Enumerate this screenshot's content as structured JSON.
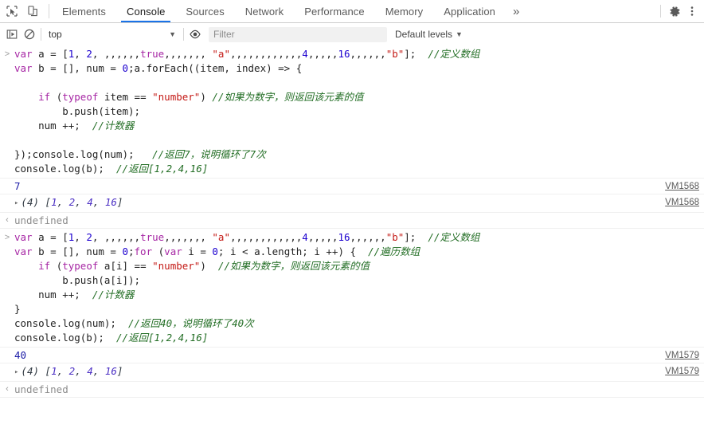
{
  "window": {
    "app": "Chrome DevTools"
  },
  "toolbar": {
    "inspect_icon": "inspect-cursor-icon",
    "device_icon": "device-toolbar-icon",
    "tabs": [
      {
        "label": "Elements",
        "active": false
      },
      {
        "label": "Console",
        "active": true
      },
      {
        "label": "Sources",
        "active": false
      },
      {
        "label": "Network",
        "active": false
      },
      {
        "label": "Performance",
        "active": false
      },
      {
        "label": "Memory",
        "active": false
      },
      {
        "label": "Application",
        "active": false
      }
    ],
    "more_tabs_label": "»",
    "settings_icon": "gear-icon",
    "menu_icon": "kebab-menu-icon"
  },
  "filterbar": {
    "execute_icon": "execute-sidebar-icon",
    "clear_icon": "clear-console-icon",
    "context": "top",
    "context_caret": "▼",
    "eye_icon": "live-expression-eye-icon",
    "filter_placeholder": "Filter",
    "filter_value": "",
    "levels_label": "Default levels",
    "levels_caret": "▼"
  },
  "console": {
    "prompt_in": ">",
    "prompt_out": "‹",
    "entries": [
      {
        "kind": "input",
        "lines": [
          [
            {
              "t": "kw",
              "s": "var"
            },
            {
              "t": "plain",
              "s": " a = ["
            },
            {
              "t": "num",
              "s": "1"
            },
            {
              "t": "plain",
              "s": ", "
            },
            {
              "t": "num",
              "s": "2"
            },
            {
              "t": "plain",
              "s": ", ,,,,,,"
            },
            {
              "t": "kw",
              "s": "true"
            },
            {
              "t": "plain",
              "s": ",,,,,,, "
            },
            {
              "t": "str",
              "s": "\"a\""
            },
            {
              "t": "plain",
              "s": ",,,,,,,,,,,,"
            },
            {
              "t": "num",
              "s": "4"
            },
            {
              "t": "plain",
              "s": ",,,,,"
            },
            {
              "t": "num",
              "s": "16"
            },
            {
              "t": "plain",
              "s": ",,,,,,"
            },
            {
              "t": "str",
              "s": "\"b\""
            },
            {
              "t": "plain",
              "s": "];  "
            },
            {
              "t": "cmt",
              "s": "//定义数组"
            }
          ],
          [
            {
              "t": "kw",
              "s": "var"
            },
            {
              "t": "plain",
              "s": " b = [], num = "
            },
            {
              "t": "num",
              "s": "0"
            },
            {
              "t": "plain",
              "s": ";a.forEach((item, index) => {"
            }
          ],
          [
            {
              "t": "plain",
              "s": ""
            }
          ],
          [
            {
              "t": "plain",
              "s": "    "
            },
            {
              "t": "kw",
              "s": "if"
            },
            {
              "t": "plain",
              "s": " ("
            },
            {
              "t": "kw",
              "s": "typeof"
            },
            {
              "t": "plain",
              "s": " item == "
            },
            {
              "t": "str",
              "s": "\"number\""
            },
            {
              "t": "plain",
              "s": ") "
            },
            {
              "t": "cmt",
              "s": "//如果为数字，则返回该元素的值"
            }
          ],
          [
            {
              "t": "plain",
              "s": "        b.push(item);"
            }
          ],
          [
            {
              "t": "plain",
              "s": "    num ++;  "
            },
            {
              "t": "cmt",
              "s": "//计数器"
            }
          ],
          [
            {
              "t": "plain",
              "s": ""
            }
          ],
          [
            {
              "t": "plain",
              "s": "});console.log(num);   "
            },
            {
              "t": "cmt",
              "s": "//返回7，说明循环了7次"
            }
          ],
          [
            {
              "t": "plain",
              "s": "console.log(b);  "
            },
            {
              "t": "cmt",
              "s": "//返回[1,2,4,16]"
            }
          ]
        ]
      },
      {
        "kind": "log-number",
        "value": "7",
        "source": "VM1568"
      },
      {
        "kind": "log-array",
        "triangle": "▸",
        "count": "(4)",
        "open": "[",
        "items": [
          "1",
          "2",
          "4",
          "16"
        ],
        "close": "]",
        "source": "VM1568"
      },
      {
        "kind": "result-undefined",
        "value": "undefined"
      },
      {
        "kind": "input",
        "lines": [
          [
            {
              "t": "kw",
              "s": "var"
            },
            {
              "t": "plain",
              "s": " a = ["
            },
            {
              "t": "num",
              "s": "1"
            },
            {
              "t": "plain",
              "s": ", "
            },
            {
              "t": "num",
              "s": "2"
            },
            {
              "t": "plain",
              "s": ", ,,,,,,"
            },
            {
              "t": "kw",
              "s": "true"
            },
            {
              "t": "plain",
              "s": ",,,,,,, "
            },
            {
              "t": "str",
              "s": "\"a\""
            },
            {
              "t": "plain",
              "s": ",,,,,,,,,,,,"
            },
            {
              "t": "num",
              "s": "4"
            },
            {
              "t": "plain",
              "s": ",,,,,"
            },
            {
              "t": "num",
              "s": "16"
            },
            {
              "t": "plain",
              "s": ",,,,,,"
            },
            {
              "t": "str",
              "s": "\"b\""
            },
            {
              "t": "plain",
              "s": "];  "
            },
            {
              "t": "cmt",
              "s": "//定义数组"
            }
          ],
          [
            {
              "t": "kw",
              "s": "var"
            },
            {
              "t": "plain",
              "s": " b = [], num = "
            },
            {
              "t": "num",
              "s": "0"
            },
            {
              "t": "plain",
              "s": ";"
            },
            {
              "t": "kw",
              "s": "for"
            },
            {
              "t": "plain",
              "s": " ("
            },
            {
              "t": "kw",
              "s": "var"
            },
            {
              "t": "plain",
              "s": " i = "
            },
            {
              "t": "num",
              "s": "0"
            },
            {
              "t": "plain",
              "s": "; i < a.length; i "
            },
            {
              "t": "op",
              "s": "++"
            },
            {
              "t": "plain",
              "s": ") {  "
            },
            {
              "t": "cmt",
              "s": "//遍历数组"
            }
          ],
          [
            {
              "t": "plain",
              "s": "    "
            },
            {
              "t": "kw",
              "s": "if"
            },
            {
              "t": "plain",
              "s": " ("
            },
            {
              "t": "kw",
              "s": "typeof"
            },
            {
              "t": "plain",
              "s": " a[i] == "
            },
            {
              "t": "str",
              "s": "\"number\""
            },
            {
              "t": "plain",
              "s": ")  "
            },
            {
              "t": "cmt",
              "s": "//如果为数字，则返回该元素的值"
            }
          ],
          [
            {
              "t": "plain",
              "s": "        b.push(a[i]);"
            }
          ],
          [
            {
              "t": "plain",
              "s": "    num ++;  "
            },
            {
              "t": "cmt",
              "s": "//计数器"
            }
          ],
          [
            {
              "t": "plain",
              "s": "}"
            }
          ],
          [
            {
              "t": "plain",
              "s": "console.log(num);  "
            },
            {
              "t": "cmt",
              "s": "//返回40，说明循环了40次"
            }
          ],
          [
            {
              "t": "plain",
              "s": "console.log(b);  "
            },
            {
              "t": "cmt",
              "s": "//返回[1,2,4,16]"
            }
          ]
        ]
      },
      {
        "kind": "log-number",
        "value": "40",
        "source": "VM1579"
      },
      {
        "kind": "log-array",
        "triangle": "▸",
        "count": "(4)",
        "open": "[",
        "items": [
          "1",
          "2",
          "4",
          "16"
        ],
        "close": "]",
        "source": "VM1579"
      },
      {
        "kind": "result-undefined",
        "value": "undefined"
      }
    ]
  },
  "colors": {
    "accent": "#1a73e8",
    "keyword": "#a626a4",
    "string": "#c41a16",
    "number": "#1c00cf",
    "comment": "#236e25",
    "result": "#1a1aa6",
    "muted": "#8c8c8c"
  }
}
